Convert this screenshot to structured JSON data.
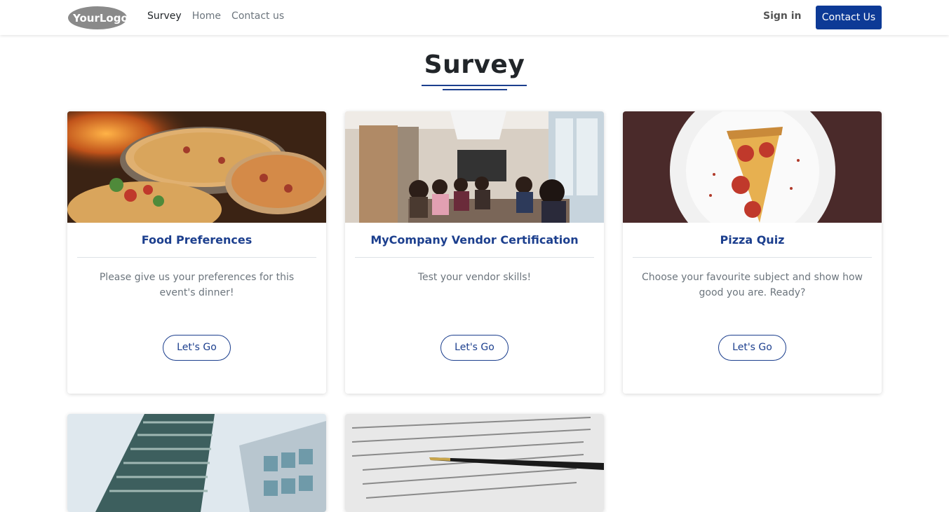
{
  "header": {
    "logo_text": "YourLogo",
    "nav": [
      "Survey",
      "Home",
      "Contact us"
    ],
    "signin_label": "Sign in",
    "contact_button_label": "Contact Us"
  },
  "page": {
    "title": "Survey"
  },
  "cards": [
    {
      "title": "Food Preferences",
      "text": "Please give us your preferences for this event's dinner!",
      "button": "Let's Go",
      "image": "pizzas-on-stands-photo"
    },
    {
      "title": "MyCompany Vendor Certification",
      "text": "Test your vendor skills!",
      "button": "Let's Go",
      "image": "meeting-room-photo"
    },
    {
      "title": "Pizza Quiz",
      "text": "Choose your favourite subject and show how good you are. Ready?",
      "button": "Let's Go",
      "image": "pizza-slice-plate-photo"
    },
    {
      "image": "office-building-photo"
    },
    {
      "image": "contract-pen-photo"
    }
  ],
  "colors": {
    "brand": "#0d3a96",
    "accent": "#1c3f8e",
    "muted": "#6c757d"
  }
}
